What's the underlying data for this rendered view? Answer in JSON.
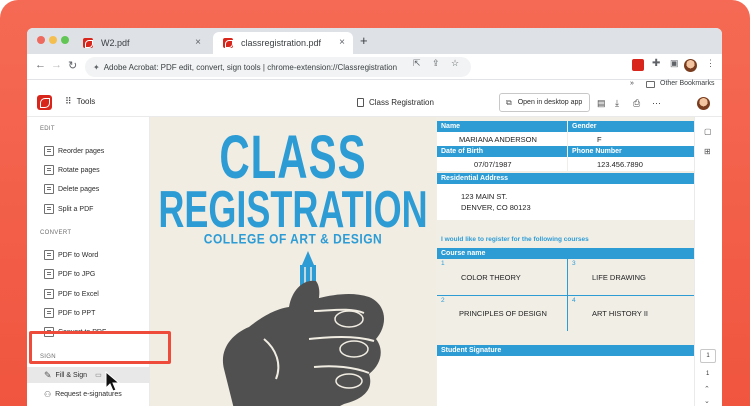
{
  "browser": {
    "tabs": [
      {
        "title": "W2.pdf",
        "close": "×"
      },
      {
        "title": "classregistration.pdf",
        "close": "×"
      }
    ],
    "new_tab": "+",
    "nav": {
      "back": "←",
      "forward": "→",
      "reload": "↻"
    },
    "address": "Adobe Acrobat: PDF edit, convert, sign tools | chrome-extension://Classregistration",
    "other_bookmarks": "Other Bookmarks",
    "bookmarks_chevron": "»",
    "menu": "⋮"
  },
  "acrobat": {
    "tools_label": "Tools",
    "doc_title": "Class Registration",
    "open_desktop_label": "Open in desktop app"
  },
  "sidebar": {
    "sections": [
      {
        "label": "EDIT",
        "items": [
          "Reorder pages",
          "Rotate pages",
          "Delete pages",
          "Split a PDF"
        ]
      },
      {
        "label": "CONVERT",
        "items": [
          "PDF to Word",
          "PDF to JPG",
          "PDF to Excel",
          "PDF to PPT",
          "Convert to PDF"
        ]
      },
      {
        "label": "SIGN",
        "items": [
          "Fill & Sign",
          "Request e-signatures"
        ]
      }
    ]
  },
  "document": {
    "title_line1": "CLASS",
    "title_line2": "REGISTRATION",
    "subtitle": "COLLEGE OF ART & DESIGN",
    "form": {
      "name_label": "Name",
      "name": "MARIANA ANDERSON",
      "gender_label": "Gender",
      "gender": "F",
      "dob_label": "Date of Birth",
      "dob": "07/07/1987",
      "phone_label": "Phone Number",
      "phone": "123.456.7890",
      "address_label": "Residential Address",
      "address_line1": "123 MAIN ST.",
      "address_line2": "DENVER, CO 80123",
      "courses_intro": "I would like to register for the following courses",
      "course_name_label": "Course name",
      "courses": [
        {
          "num": "1",
          "name": "COLOR THEORY"
        },
        {
          "num": "3",
          "name": "LIFE DRAWING"
        },
        {
          "num": "2",
          "name": "PRINCIPLES OF DESIGN"
        },
        {
          "num": "4",
          "name": "ART HISTORY II"
        }
      ],
      "signature_label": "Student Signature"
    }
  },
  "pager": {
    "current": "1",
    "total": "1"
  },
  "colors": {
    "accent_blue": "#2d9cd5",
    "highlight_red": "#ef4b3a",
    "acrobat_red": "#d9261c"
  }
}
